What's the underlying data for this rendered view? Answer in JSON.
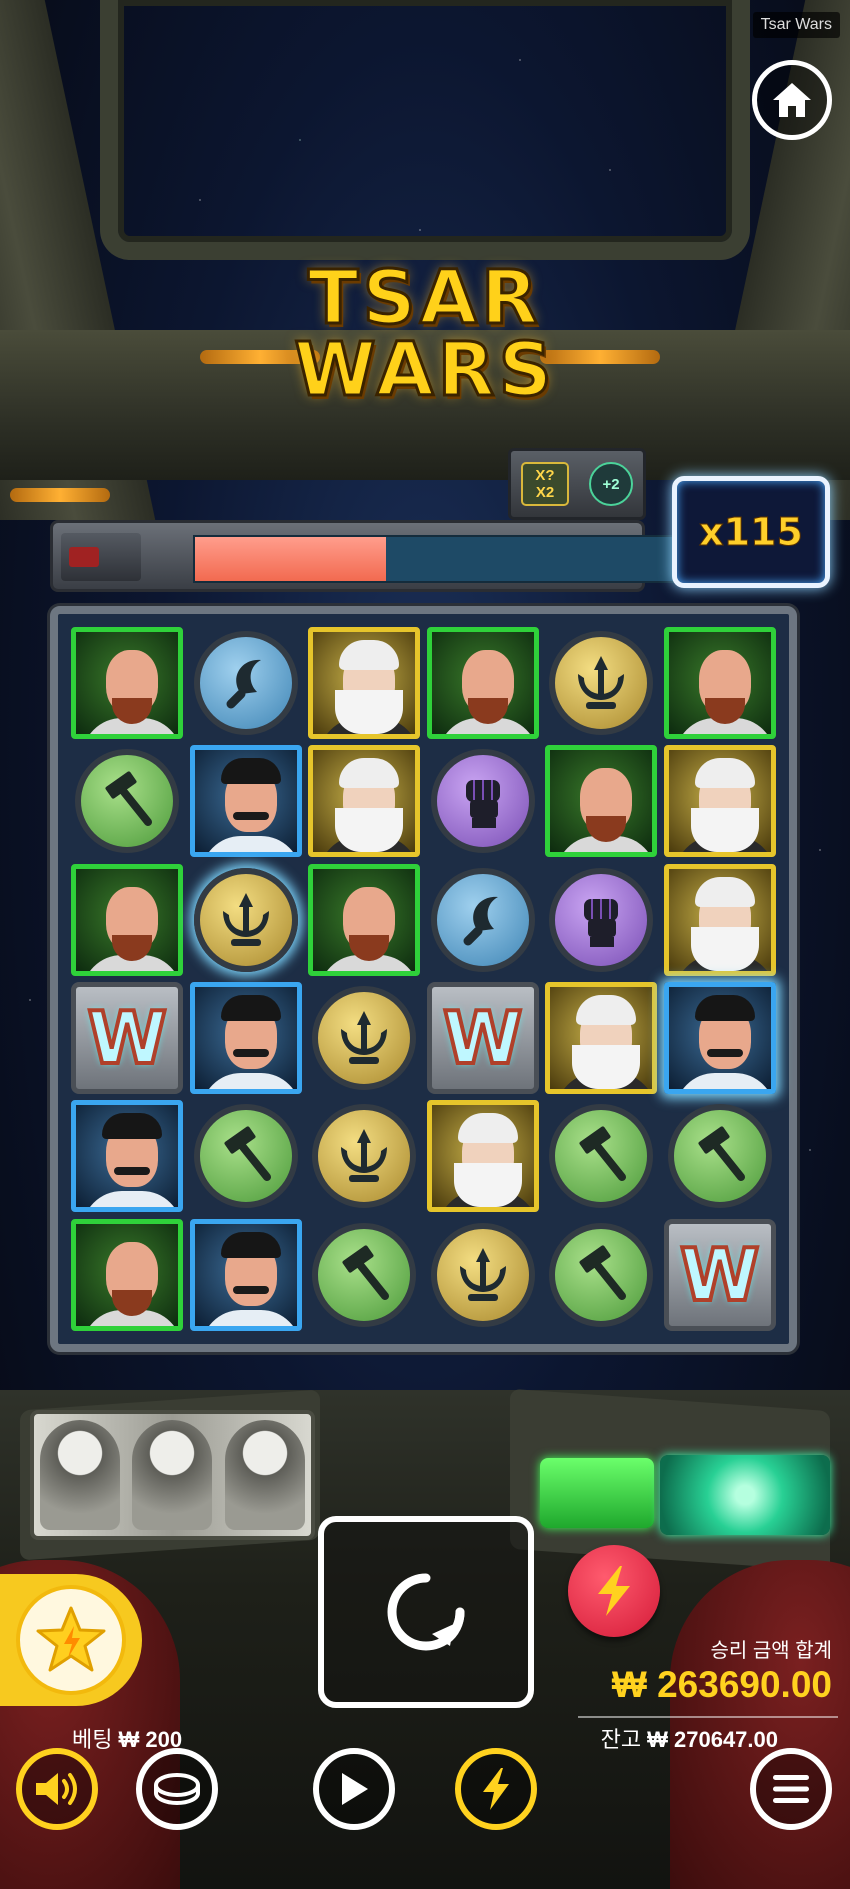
{
  "header": {
    "game_label": "Tsar Wars"
  },
  "logo": {
    "line1": "TSAR",
    "line2": "WARS"
  },
  "meter": {
    "progress": 0.39
  },
  "bonus": {
    "xp_top": "X?",
    "xp_bottom": "X2",
    "spins_label": "+2"
  },
  "multiplier": "x115",
  "grid": [
    [
      "lenin",
      "sickle",
      "marx",
      "lenin",
      "trident",
      "lenin"
    ],
    [
      "hammer",
      "stalin",
      "marx",
      "fist",
      "lenin",
      "marx"
    ],
    [
      "lenin",
      "trident-hl",
      "lenin",
      "sickle",
      "fist",
      "marx"
    ],
    [
      "wild",
      "stalin",
      "trident",
      "wild",
      "marx",
      "stalin-hl"
    ],
    [
      "stalin",
      "hammer",
      "trident",
      "marx",
      "hammer",
      "hammer"
    ],
    [
      "lenin",
      "stalin",
      "hammer",
      "trident",
      "hammer",
      "wild"
    ]
  ],
  "wild_letter": "W",
  "win": {
    "label": "승리 금액 합계",
    "amount": "₩ 263690.00"
  },
  "bet": {
    "label": "베팅",
    "value": "₩ 200"
  },
  "balance": {
    "label": "잔고",
    "value": "₩ 270647.00"
  },
  "colors": {
    "accent_gold": "#ffd21f",
    "turbo_red": "#d41a38",
    "highlight": "#7fd8ff"
  }
}
